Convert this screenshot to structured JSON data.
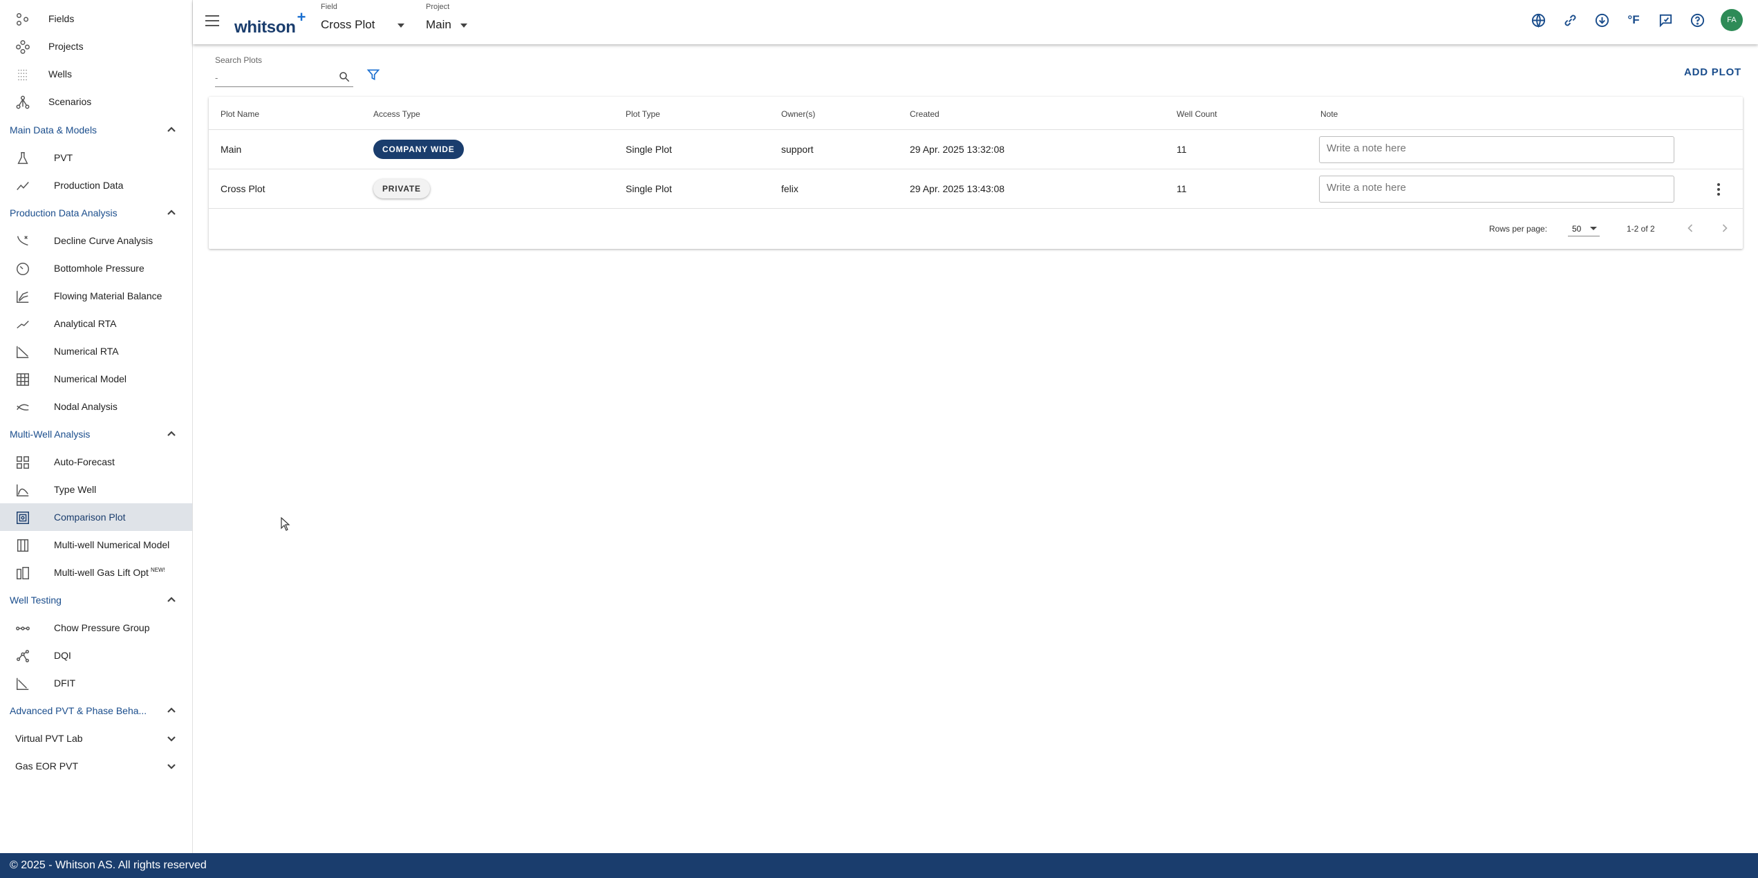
{
  "sidebar": {
    "top_items": [
      {
        "label": "Fields",
        "icon": "fields-icon"
      },
      {
        "label": "Projects",
        "icon": "projects-icon"
      },
      {
        "label": "Wells",
        "icon": "wells-icon"
      },
      {
        "label": "Scenarios",
        "icon": "scenarios-icon"
      }
    ],
    "sections": [
      {
        "title": "Main Data & Models",
        "items": [
          {
            "label": "PVT",
            "icon": "flask-icon"
          },
          {
            "label": "Production Data",
            "icon": "trend-line-icon"
          }
        ]
      },
      {
        "title": "Production Data Analysis",
        "items": [
          {
            "label": "Decline Curve Analysis",
            "icon": "decline-curve-icon"
          },
          {
            "label": "Bottomhole Pressure",
            "icon": "gauge-icon"
          },
          {
            "label": "Flowing Material Balance",
            "icon": "chart-lines-icon"
          },
          {
            "label": "Analytical RTA",
            "icon": "trend-line-icon"
          },
          {
            "label": "Numerical RTA",
            "icon": "numerical-rta-icon"
          },
          {
            "label": "Numerical Model",
            "icon": "grid-model-icon"
          },
          {
            "label": "Nodal Analysis",
            "icon": "nodal-icon"
          }
        ]
      },
      {
        "title": "Multi-Well Analysis",
        "items": [
          {
            "label": "Auto-Forecast",
            "icon": "grid-four-icon"
          },
          {
            "label": "Type Well",
            "icon": "type-well-icon"
          },
          {
            "label": "Comparison Plot",
            "icon": "comparison-plot-icon"
          },
          {
            "label": "Multi-well Numerical Model",
            "icon": "columns-icon"
          },
          {
            "label": "Multi-well Gas Lift Opt",
            "icon": "gas-lift-icon",
            "badge": "NEW!"
          }
        ]
      },
      {
        "title": "Well Testing",
        "items": [
          {
            "label": "Chow Pressure Group",
            "icon": "chow-icon"
          },
          {
            "label": "DQI",
            "icon": "dqi-icon"
          },
          {
            "label": "DFIT",
            "icon": "dfit-icon"
          }
        ]
      },
      {
        "title": "Advanced PVT & Phase Beha...",
        "items": [
          {
            "label": "Virtual PVT Lab"
          },
          {
            "label": "Gas EOR PVT"
          }
        ]
      }
    ],
    "selected": "Comparison Plot"
  },
  "header": {
    "logo": "whitson",
    "logo_plus": "+",
    "field_caption": "Field",
    "field_value": "Cross Plot",
    "project_caption": "Project",
    "project_value": "Main",
    "icons": [
      "globe-icon",
      "link-icon",
      "download-icon",
      "fahrenheit-icon",
      "feedback-icon",
      "help-icon"
    ],
    "unit_label": "°F",
    "avatar_initials": "FA"
  },
  "search": {
    "caption": "Search Plots",
    "placeholder": "-"
  },
  "actions": {
    "add_plot": "ADD PLOT"
  },
  "table": {
    "columns": [
      "Plot Name",
      "Access Type",
      "Plot Type",
      "Owner(s)",
      "Created",
      "Well Count",
      "Note"
    ],
    "rows": [
      {
        "name": "Main",
        "access": "COMPANY WIDE",
        "access_style": "company",
        "type": "Single Plot",
        "owner": "support",
        "created": "29 Apr. 2025 13:32:08",
        "well_count": "11",
        "note_placeholder": "Write a note here"
      },
      {
        "name": "Cross Plot",
        "access": "PRIVATE",
        "access_style": "private",
        "type": "Single Plot",
        "owner": "felix",
        "created": "29 Apr. 2025 13:43:08",
        "well_count": "11",
        "note_placeholder": "Write a note here"
      }
    ],
    "pagination": {
      "rows_per_page_label": "Rows per page:",
      "rows_per_page": "50",
      "range": "1-2 of 2"
    }
  },
  "footer": {
    "text": "© 2025 - Whitson AS. All rights reserved"
  },
  "colors": {
    "primary": "#1a3d6d",
    "accent": "#1a6fd0",
    "avatar": "#2e8b57",
    "selected_bg": "#dfe3e8"
  }
}
